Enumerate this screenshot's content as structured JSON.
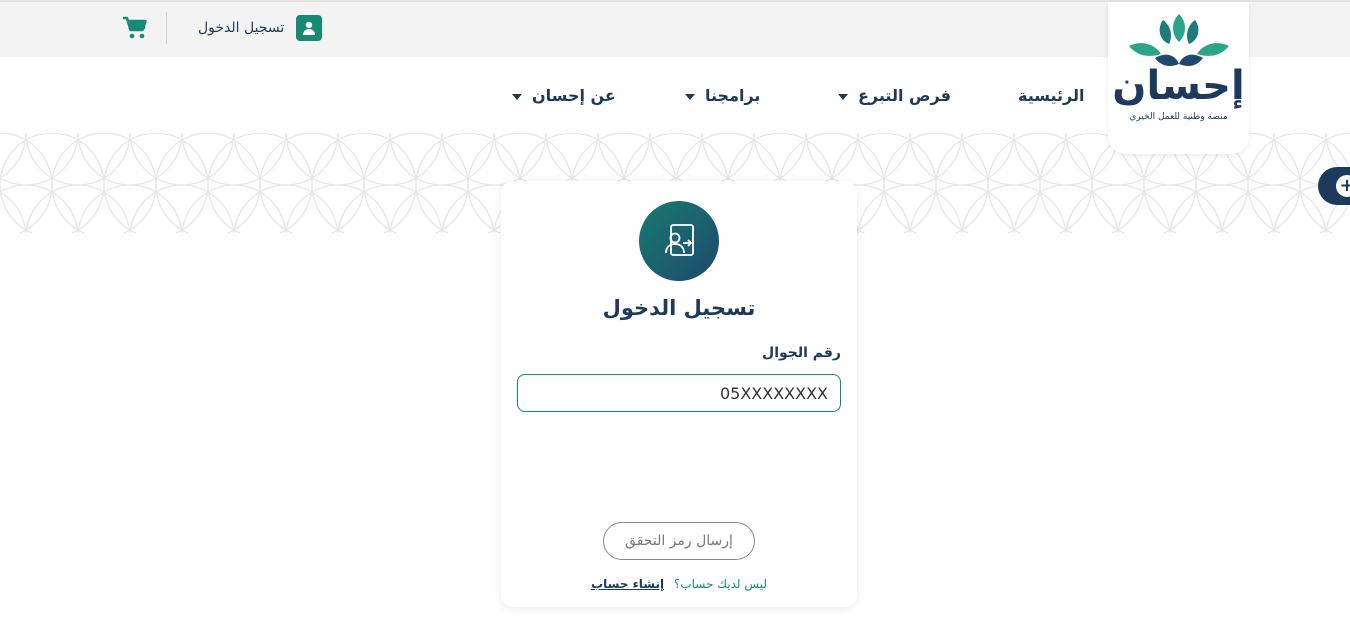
{
  "top_bar": {
    "login_label": "تسجيل الدخول",
    "cart_icon": "cart-icon",
    "user_icon": "user-icon"
  },
  "brand": {
    "name": "إحسان",
    "tagline": "منصة وطنية للعمل الخيري",
    "primary_color": "#1d3a5c",
    "accent_color": "#168a72"
  },
  "nav": {
    "items": [
      {
        "label": "الرئيسية",
        "has_dropdown": false
      },
      {
        "label": "فرص التبرع",
        "has_dropdown": true
      },
      {
        "label": "برامجنا",
        "has_dropdown": true
      },
      {
        "label": "عن إحسان",
        "has_dropdown": true
      }
    ]
  },
  "side_button": {
    "icon": "plus-icon"
  },
  "login_card": {
    "icon": "login-door-icon",
    "title": "تسجيل الدخول",
    "phone_label": "رقم الجوال",
    "phone_placeholder": "05XXXXXXXX",
    "send_button": "إرسال رمز التحقق",
    "no_account_text": "ليس لديك حساب؟",
    "create_account_link": "إنشاء حساب"
  }
}
